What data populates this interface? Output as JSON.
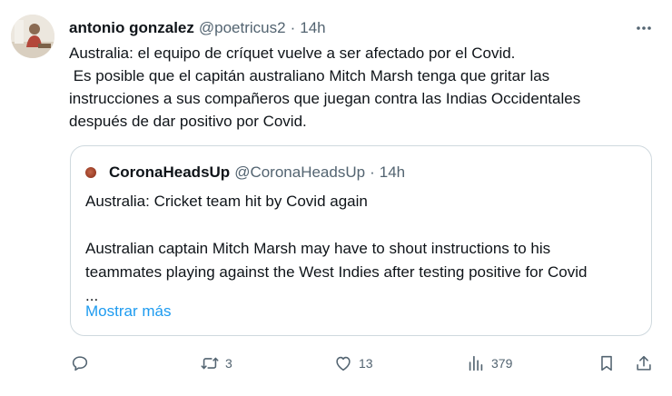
{
  "tweet": {
    "author_name": "antonio gonzalez",
    "author_handle": "@poetricus2",
    "separator": "·",
    "time": "14h",
    "text_lines": [
      "Australia: el equipo de críquet vuelve a ser afectado por el Covid.",
      " Es posible que el capitán australiano Mitch Marsh tenga que gritar las",
      "instrucciones a sus compañeros que juegan contra las Indias Occidentales",
      "después de dar positivo por Covid."
    ]
  },
  "quote": {
    "author_name": "CoronaHeadsUp",
    "author_handle": "@CoronaHeadsUp",
    "separator": "·",
    "time": "14h",
    "text_lines": [
      "Australia: Cricket team hit by Covid again",
      " ",
      "Australian captain Mitch Marsh may have to shout instructions to his",
      "teammates playing against the West Indies after testing positive for Covid",
      "..."
    ],
    "show_more_label": "Mostrar más"
  },
  "actions": {
    "reply_count": "",
    "retweet_count": "3",
    "like_count": "13",
    "views_count": "379"
  },
  "icons": {
    "more": "more-horizontal-icon",
    "reply": "reply-icon",
    "retweet": "retweet-icon",
    "like": "heart-icon",
    "views": "views-chart-icon",
    "bookmark": "bookmark-icon",
    "share": "share-icon"
  },
  "colors": {
    "text": "#0f1419",
    "secondary": "#536471",
    "link": "#1d9bf0",
    "border": "#cfd9de"
  }
}
